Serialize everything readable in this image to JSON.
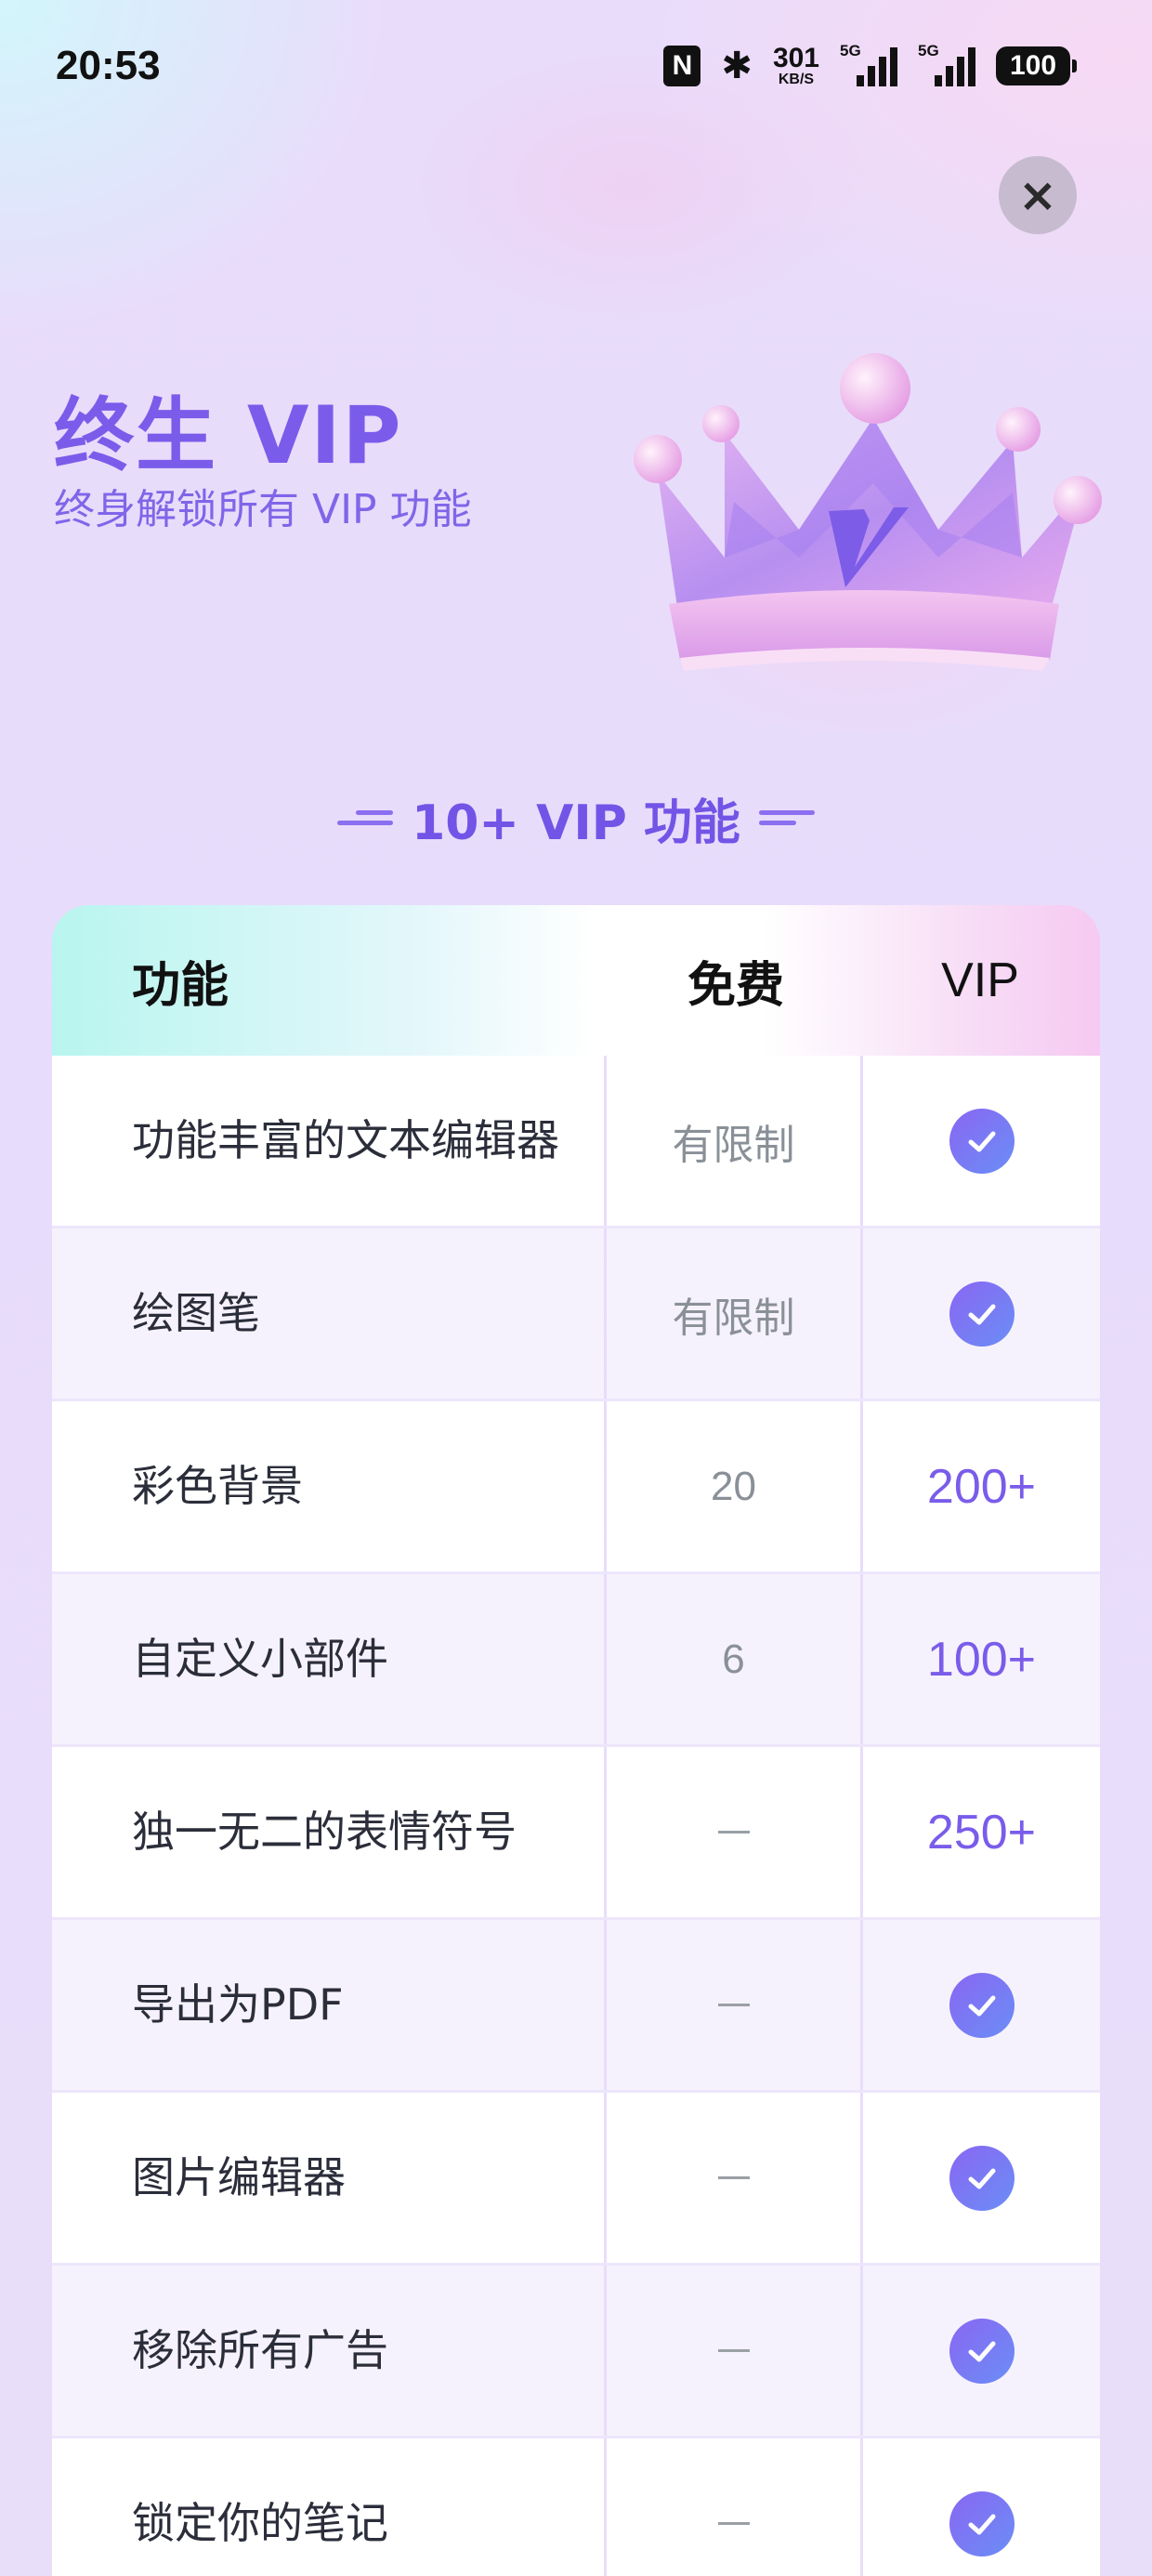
{
  "status_bar": {
    "time": "20:53",
    "nfc": "N",
    "bluetooth": "✱",
    "net_speed_value": "301",
    "net_speed_unit": "KB/S",
    "sim1_tag": "5G",
    "sim2_tag": "5G",
    "battery": "100"
  },
  "header": {
    "close_icon": "×",
    "title": "终生 VIP",
    "subtitle": "终身解锁所有 VIP 功能"
  },
  "section": {
    "title": "10+ VIP 功能"
  },
  "table": {
    "headers": {
      "feature": "功能",
      "free": "免费",
      "vip": "VIP"
    },
    "rows": [
      {
        "feature": "功能丰富的文本编辑器",
        "free": "有限制",
        "vip": "check"
      },
      {
        "feature": "绘图笔",
        "free": "有限制",
        "vip": "check"
      },
      {
        "feature": "彩色背景",
        "free": "20",
        "vip": "200+"
      },
      {
        "feature": "自定义小部件",
        "free": "6",
        "vip": "100+"
      },
      {
        "feature": "独一无二的表情符号",
        "free": "–",
        "vip": "250+"
      },
      {
        "feature": "导出为PDF",
        "free": "–",
        "vip": "check"
      },
      {
        "feature": "图片编辑器",
        "free": "–",
        "vip": "check"
      },
      {
        "feature": "移除所有广告",
        "free": "–",
        "vip": "check"
      },
      {
        "feature": "锁定你的笔记",
        "free": "–",
        "vip": "check"
      }
    ]
  },
  "colors": {
    "accent": "#7a5cea",
    "check_gradient_start": "#8a66f2",
    "check_gradient_end": "#6a8ef6"
  }
}
